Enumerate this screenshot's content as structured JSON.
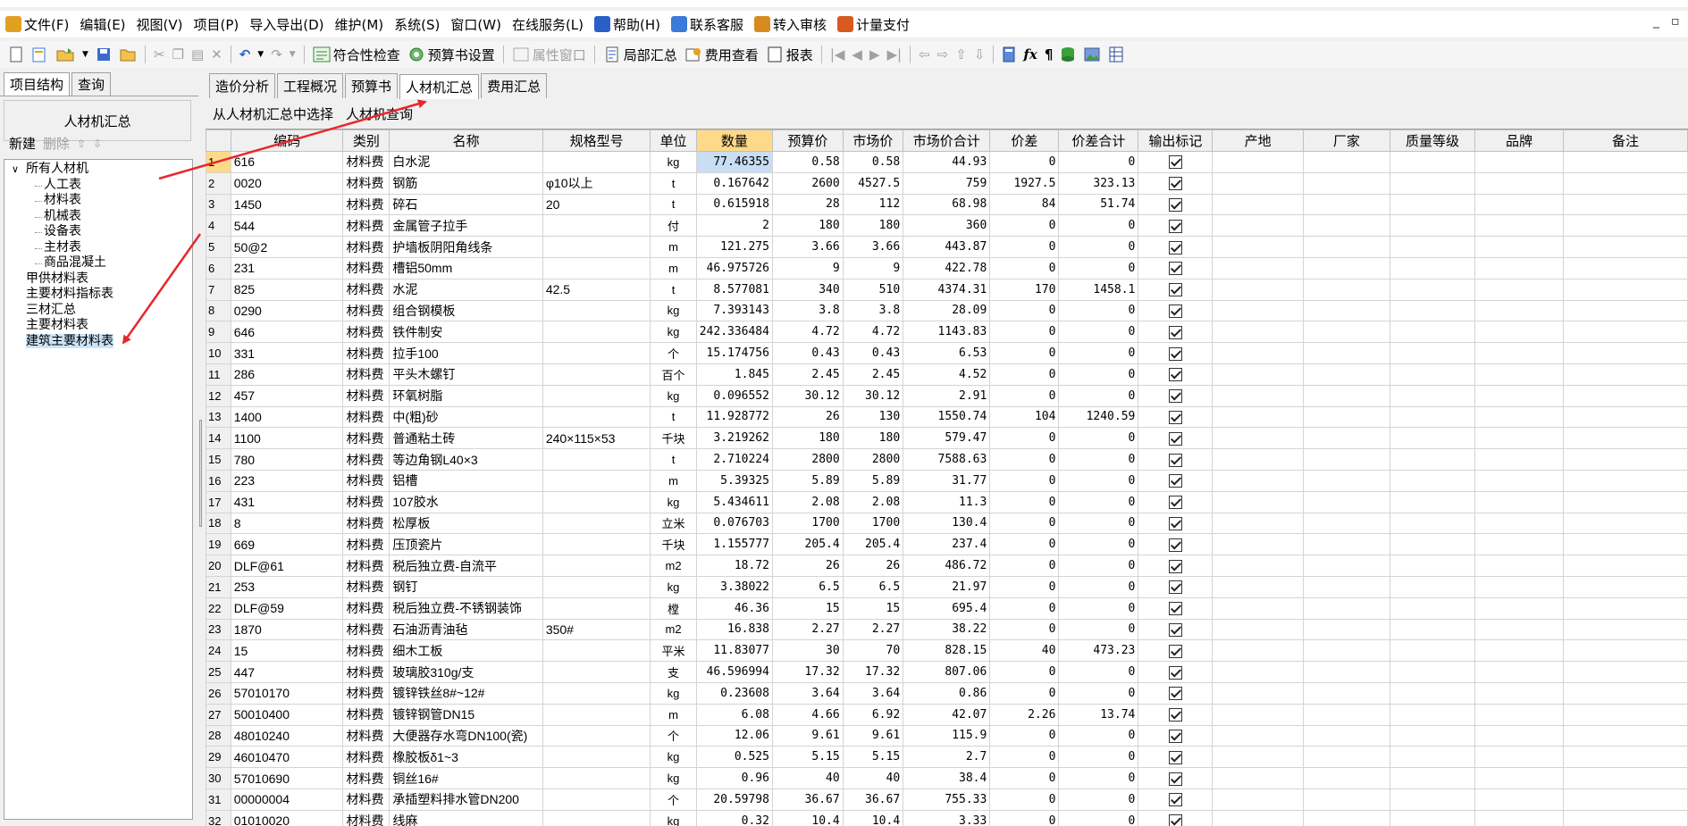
{
  "menu": [
    {
      "label": "文件(F)",
      "icon": "app-icon",
      "color": "#e0a020"
    },
    {
      "label": "编辑(E)"
    },
    {
      "label": "视图(V)"
    },
    {
      "label": "项目(P)"
    },
    {
      "label": "导入导出(D)"
    },
    {
      "label": "维护(M)"
    },
    {
      "label": "系统(S)"
    },
    {
      "label": "窗口(W)"
    },
    {
      "label": "在线服务(L)"
    },
    {
      "label": "帮助(H)",
      "icon": "help-icon",
      "color": "#2a5fc8"
    },
    {
      "label": "联系客服",
      "icon": "customer-service-icon",
      "color": "#3a7ad8"
    },
    {
      "label": "转入审核",
      "icon": "audit-icon",
      "color": "#d88a20"
    },
    {
      "label": "计量支付",
      "icon": "payment-icon",
      "color": "#d85a20"
    }
  ],
  "toolbar": {
    "compliance_check": "符合性检查",
    "budget_settings": "预算书设置",
    "property_window": "属性窗口",
    "partial_summary": "局部汇总",
    "fee_view": "费用查看",
    "report": "报表"
  },
  "left_panel": {
    "tabs": [
      "项目结构",
      "查询"
    ],
    "header": "人材机汇总",
    "new_label": "新建",
    "delete_label": "删除",
    "tree": [
      {
        "label": "所有人材机",
        "level": 0,
        "expanded": true
      },
      {
        "label": "人工表",
        "level": 1
      },
      {
        "label": "材料表",
        "level": 1
      },
      {
        "label": "机械表",
        "level": 1
      },
      {
        "label": "设备表",
        "level": 1
      },
      {
        "label": "主材表",
        "level": 1
      },
      {
        "label": "商品混凝土",
        "level": 1
      },
      {
        "label": "甲供材料表",
        "level": 0
      },
      {
        "label": "主要材料指标表",
        "level": 0
      },
      {
        "label": "三材汇总",
        "level": 0
      },
      {
        "label": "主要材料表",
        "level": 0
      },
      {
        "label": "建筑主要材料表",
        "level": 0,
        "selected": true
      }
    ]
  },
  "main_tabs": [
    "造价分析",
    "工程概况",
    "预算书",
    "人材机汇总",
    "费用汇总"
  ],
  "active_tab": 3,
  "subbar": {
    "select_from_summary": "从人材机汇总中选择",
    "query": "人材机查询"
  },
  "table": {
    "columns": [
      "编码",
      "类别",
      "名称",
      "规格型号",
      "单位",
      "数量",
      "预算价",
      "市场价",
      "市场价合计",
      "价差",
      "价差合计",
      "输出标记",
      "产地",
      "厂家",
      "质量等级",
      "品牌",
      "备注"
    ],
    "rows": [
      [
        "1",
        "616",
        "材料费",
        "白水泥",
        "",
        "kg",
        "77.46355",
        "0.58",
        "0.58",
        "44.93",
        "0",
        "0"
      ],
      [
        "2",
        "0020",
        "材料费",
        "钢筋",
        "φ10以上",
        "t",
        "0.167642",
        "2600",
        "4527.5",
        "759",
        "1927.5",
        "323.13"
      ],
      [
        "3",
        "1450",
        "材料费",
        "碎石",
        "20",
        "t",
        "0.615918",
        "28",
        "112",
        "68.98",
        "84",
        "51.74"
      ],
      [
        "4",
        "544",
        "材料费",
        "金属管子拉手",
        "",
        "付",
        "2",
        "180",
        "180",
        "360",
        "0",
        "0"
      ],
      [
        "5",
        "50@2",
        "材料费",
        "护墙板阴阳角线条",
        "",
        "m",
        "121.275",
        "3.66",
        "3.66",
        "443.87",
        "0",
        "0"
      ],
      [
        "6",
        "231",
        "材料费",
        "槽铝50mm",
        "",
        "m",
        "46.975726",
        "9",
        "9",
        "422.78",
        "0",
        "0"
      ],
      [
        "7",
        "825",
        "材料费",
        "水泥",
        "42.5",
        "t",
        "8.577081",
        "340",
        "510",
        "4374.31",
        "170",
        "1458.1"
      ],
      [
        "8",
        "0290",
        "材料费",
        "组合钢模板",
        "",
        "kg",
        "7.393143",
        "3.8",
        "3.8",
        "28.09",
        "0",
        "0"
      ],
      [
        "9",
        "646",
        "材料费",
        "铁件制安",
        "",
        "kg",
        "242.336484",
        "4.72",
        "4.72",
        "1143.83",
        "0",
        "0"
      ],
      [
        "10",
        "331",
        "材料费",
        "拉手100",
        "",
        "个",
        "15.174756",
        "0.43",
        "0.43",
        "6.53",
        "0",
        "0"
      ],
      [
        "11",
        "286",
        "材料费",
        "平头木螺钉",
        "",
        "百个",
        "1.845",
        "2.45",
        "2.45",
        "4.52",
        "0",
        "0"
      ],
      [
        "12",
        "457",
        "材料费",
        "环氧树脂",
        "",
        "kg",
        "0.096552",
        "30.12",
        "30.12",
        "2.91",
        "0",
        "0"
      ],
      [
        "13",
        "1400",
        "材料费",
        "中(粗)砂",
        "",
        "t",
        "11.928772",
        "26",
        "130",
        "1550.74",
        "104",
        "1240.59"
      ],
      [
        "14",
        "1100",
        "材料费",
        "普通粘土砖",
        "240×115×53",
        "千块",
        "3.219262",
        "180",
        "180",
        "579.47",
        "0",
        "0"
      ],
      [
        "15",
        "780",
        "材料费",
        "等边角钢L40×3",
        "",
        "t",
        "2.710224",
        "2800",
        "2800",
        "7588.63",
        "0",
        "0"
      ],
      [
        "16",
        "223",
        "材料费",
        "铝槽",
        "",
        "m",
        "5.39325",
        "5.89",
        "5.89",
        "31.77",
        "0",
        "0"
      ],
      [
        "17",
        "431",
        "材料费",
        "107胶水",
        "",
        "kg",
        "5.434611",
        "2.08",
        "2.08",
        "11.3",
        "0",
        "0"
      ],
      [
        "18",
        "8",
        "材料费",
        "松厚板",
        "",
        "立米",
        "0.076703",
        "1700",
        "1700",
        "130.4",
        "0",
        "0"
      ],
      [
        "19",
        "669",
        "材料费",
        "压顶瓷片",
        "",
        "千块",
        "1.155777",
        "205.4",
        "205.4",
        "237.4",
        "0",
        "0"
      ],
      [
        "20",
        "DLF@61",
        "材料费",
        "税后独立费-自流平",
        "",
        "m2",
        "18.72",
        "26",
        "26",
        "486.72",
        "0",
        "0"
      ],
      [
        "21",
        "253",
        "材料费",
        "钢钉",
        "",
        "kg",
        "3.38022",
        "6.5",
        "6.5",
        "21.97",
        "0",
        "0"
      ],
      [
        "22",
        "DLF@59",
        "材料费",
        "税后独立费-不锈钢装饰",
        "",
        "樘",
        "46.36",
        "15",
        "15",
        "695.4",
        "0",
        "0"
      ],
      [
        "23",
        "1870",
        "材料费",
        "石油沥青油毡",
        "350#",
        "m2",
        "16.838",
        "2.27",
        "2.27",
        "38.22",
        "0",
        "0"
      ],
      [
        "24",
        "15",
        "材料费",
        "细木工板",
        "",
        "平米",
        "11.83077",
        "30",
        "70",
        "828.15",
        "40",
        "473.23"
      ],
      [
        "25",
        "447",
        "材料费",
        "玻璃胶310g/支",
        "",
        "支",
        "46.596994",
        "17.32",
        "17.32",
        "807.06",
        "0",
        "0"
      ],
      [
        "26",
        "57010170",
        "材料费",
        "镀锌铁丝8#~12#",
        "",
        "kg",
        "0.23608",
        "3.64",
        "3.64",
        "0.86",
        "0",
        "0"
      ],
      [
        "27",
        "50010400",
        "材料费",
        "镀锌钢管DN15",
        "",
        "m",
        "6.08",
        "4.66",
        "6.92",
        "42.07",
        "2.26",
        "13.74"
      ],
      [
        "28",
        "48010240",
        "材料费",
        "大便器存水弯DN100(瓷)",
        "",
        "个",
        "12.06",
        "9.61",
        "9.61",
        "115.9",
        "0",
        "0"
      ],
      [
        "29",
        "46010470",
        "材料费",
        "橡胶板δ1~3",
        "",
        "kg",
        "0.525",
        "5.15",
        "5.15",
        "2.7",
        "0",
        "0"
      ],
      [
        "30",
        "57010690",
        "材料费",
        "铜丝16#",
        "",
        "kg",
        "0.96",
        "40",
        "40",
        "38.4",
        "0",
        "0"
      ],
      [
        "31",
        "00000004",
        "材料费",
        "承插塑料排水管DN200",
        "",
        "个",
        "20.59798",
        "36.67",
        "36.67",
        "755.33",
        "0",
        "0"
      ],
      [
        "32",
        "01010020",
        "材料费",
        "线麻",
        "",
        "kg",
        "0.32",
        "10.4",
        "10.4",
        "3.33",
        "0",
        "0"
      ]
    ]
  },
  "colors": {
    "accent_tab": "#ffd98a",
    "selection": "#c9ddf5",
    "arrow": "#e8282c"
  }
}
